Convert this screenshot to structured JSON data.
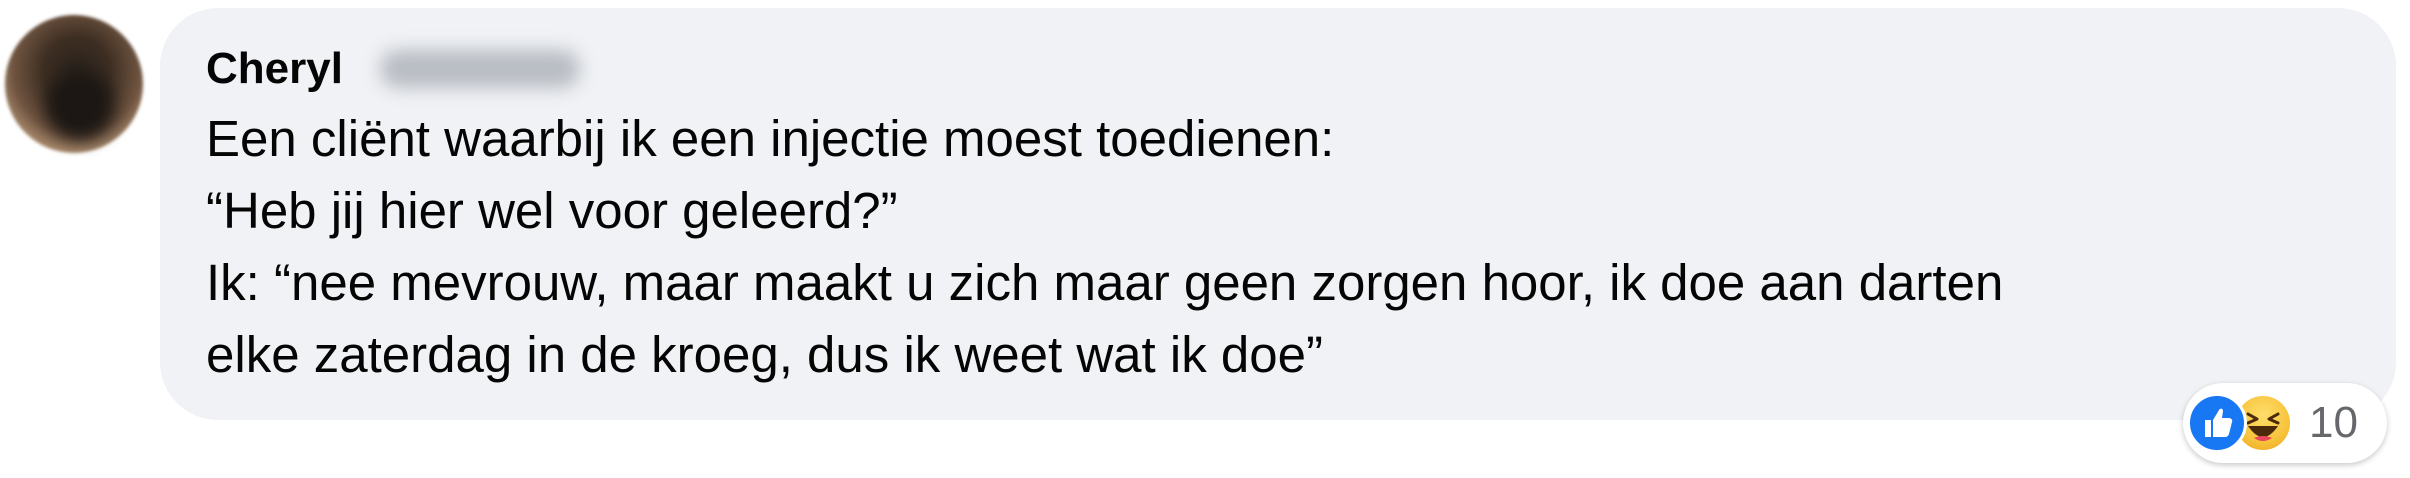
{
  "comment": {
    "author_first_name": "Cheryl",
    "lines": [
      "Een cliënt waarbij ik een injectie moest toedienen:",
      "“Heb jij hier wel voor geleerd?”",
      "Ik: “nee mevrouw, maar maakt u zich maar geen zorgen hoor, ik doe aan darten",
      "elke zaterdag in de kroeg, dus ik weet wat ik doe”"
    ]
  },
  "reactions": {
    "icons": [
      "like-icon",
      "haha-icon"
    ],
    "count": "10"
  },
  "colors": {
    "bubble_bg": "#f0f2f5",
    "text": "#050505",
    "like_blue": "#1877f2",
    "haha_yellow": "#f7c33c",
    "count_gray": "#65676b"
  }
}
